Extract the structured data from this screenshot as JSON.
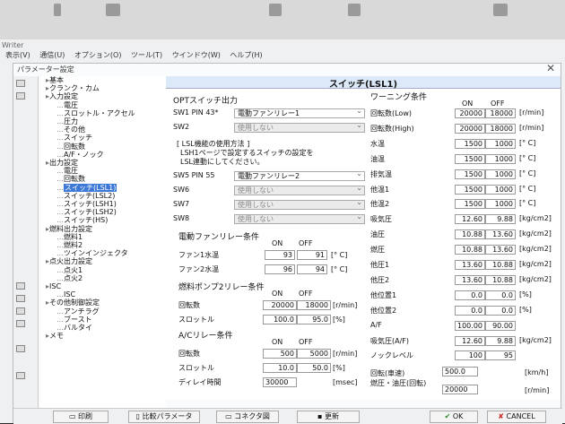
{
  "app": {
    "title": "Writer",
    "menu": [
      "表示(V)",
      "通信(U)",
      "オプション(O)",
      "ツール(T)",
      "ウインドウ(W)",
      "ヘルプ(H)"
    ],
    "dialog_title": "パラメーター設定"
  },
  "tree": [
    {
      "label": "基本",
      "indent": 0
    },
    {
      "label": "クランク・カム",
      "indent": 0
    },
    {
      "label": "入力設定",
      "indent": 0
    },
    {
      "label": "電圧",
      "indent": 1
    },
    {
      "label": "スロットル・アクセル",
      "indent": 1
    },
    {
      "label": "圧力",
      "indent": 1
    },
    {
      "label": "その他",
      "indent": 1
    },
    {
      "label": "スイッチ",
      "indent": 1
    },
    {
      "label": "回転数",
      "indent": 1
    },
    {
      "label": "A/F・ノック",
      "indent": 1
    },
    {
      "label": "出力設定",
      "indent": 0
    },
    {
      "label": "電圧",
      "indent": 1
    },
    {
      "label": "回転数",
      "indent": 1
    },
    {
      "label": "スイッチ(LSL1)",
      "indent": 1,
      "selected": true
    },
    {
      "label": "スイッチ(LSL2)",
      "indent": 1
    },
    {
      "label": "スイッチ(LSH1)",
      "indent": 1
    },
    {
      "label": "スイッチ(LSH2)",
      "indent": 1
    },
    {
      "label": "スイッチ(HS)",
      "indent": 1
    },
    {
      "label": "燃料出力設定",
      "indent": 0
    },
    {
      "label": "燃料1",
      "indent": 1
    },
    {
      "label": "燃料2",
      "indent": 1
    },
    {
      "label": "ツインインジェクタ",
      "indent": 1
    },
    {
      "label": "点火出力設定",
      "indent": 0
    },
    {
      "label": "点火1",
      "indent": 1
    },
    {
      "label": "点火2",
      "indent": 1
    },
    {
      "label": "ISC",
      "indent": 0
    },
    {
      "label": "ISC",
      "indent": 1
    },
    {
      "label": "その他制御設定",
      "indent": 0
    },
    {
      "label": "アンチラグ",
      "indent": 1
    },
    {
      "label": "ブースト",
      "indent": 1
    },
    {
      "label": "バルタイ",
      "indent": 1
    },
    {
      "label": "メモ",
      "indent": 0
    }
  ],
  "panel": {
    "title": "スイッチ(LSL1)",
    "opt_header": "OPTスイッチ出力",
    "sw1_label": "SW1 PIN 43*",
    "sw1_value": "電動ファンリレー1",
    "sw2_label": "SW2",
    "sw2_value": "使用しない",
    "note_line1": "[ LSL機能の使用方法 ]",
    "note_line2": "LSH1ページで設定するスイッチの設定を",
    "note_line3": "LSL連動にしてください。",
    "sw5_label": "SW5 PIN 55",
    "sw5_value": "電動ファンリレー2",
    "sw6_label": "SW6",
    "sw6_value": "使用しない",
    "sw7_label": "SW7",
    "sw7_value": "使用しない",
    "sw8_label": "SW8",
    "sw8_value": "使用しない",
    "fan_header": "電動ファンリレー条件",
    "on": "ON",
    "off": "OFF",
    "fan1_label": "ファン1水温",
    "fan1_on": "93",
    "fan1_off": "91",
    "fan1_unit": "[° C]",
    "fan2_label": "ファン2水温",
    "fan2_on": "96",
    "fan2_off": "94",
    "fan2_unit": "[° C]",
    "pump_header": "燃料ポンプ2リレー条件",
    "pump_rpm_label": "回転数",
    "pump_rpm_on": "20000",
    "pump_rpm_off": "18000",
    "pump_rpm_unit": "[r/min]",
    "pump_thr_label": "スロットル",
    "pump_thr_on": "100.0",
    "pump_thr_off": "95.0",
    "pump_thr_unit": "[%]",
    "ac_header": "A/Cリレー条件",
    "ac_rpm_label": "回転数",
    "ac_rpm_on": "500",
    "ac_rpm_off": "5000",
    "ac_rpm_unit": "[r/min]",
    "ac_thr_label": "スロットル",
    "ac_thr_on": "10.0",
    "ac_thr_off": "50.0",
    "ac_thr_unit": "[%]",
    "delay_label": "ディレイ時間",
    "delay_value": "30000",
    "delay_unit": "[msec]",
    "warn_header": "ワーニング条件",
    "warnings": [
      {
        "label": "回転数(Low)",
        "on": "20000",
        "off": "18000",
        "unit": "[r/min]"
      },
      {
        "label": "回転数(High)",
        "on": "20000",
        "off": "18000",
        "unit": "[r/min]"
      },
      {
        "label": "水温",
        "on": "1500",
        "off": "1000",
        "unit": "[° C]"
      },
      {
        "label": "油温",
        "on": "1500",
        "off": "1000",
        "unit": "[° C]"
      },
      {
        "label": "排気温",
        "on": "1500",
        "off": "1000",
        "unit": "[° C]"
      },
      {
        "label": "他温1",
        "on": "1500",
        "off": "1000",
        "unit": "[° C]"
      },
      {
        "label": "他温2",
        "on": "1500",
        "off": "1000",
        "unit": "[° C]"
      },
      {
        "label": "吸気圧",
        "on": "12.60",
        "off": "9.88",
        "unit": "[kg/cm2]"
      },
      {
        "label": "油圧",
        "on": "10.88",
        "off": "13.60",
        "unit": "[kg/cm2]"
      },
      {
        "label": "燃圧",
        "on": "10.88",
        "off": "13.60",
        "unit": "[kg/cm2]"
      },
      {
        "label": "他圧1",
        "on": "13.60",
        "off": "10.88",
        "unit": "[kg/cm2]"
      },
      {
        "label": "他圧2",
        "on": "13.60",
        "off": "10.88",
        "unit": "[kg/cm2]"
      },
      {
        "label": "他位置1",
        "on": "0.0",
        "off": "0.0",
        "unit": "[%]"
      },
      {
        "label": "他位置2",
        "on": "0.0",
        "off": "0.0",
        "unit": "[%]"
      },
      {
        "label": "A/F",
        "on": "100.00",
        "off": "90.00",
        "unit": ""
      },
      {
        "label": "吸気圧(A/F)",
        "on": "12.60",
        "off": "9.88",
        "unit": "[kg/cm2]"
      },
      {
        "label": "ノックレベル",
        "on": "100",
        "off": "95",
        "unit": ""
      }
    ],
    "speed_label": "回転(車速)",
    "speed_value": "500.0",
    "speed_unit": "[km/h]",
    "fuel_label": "燃圧・油圧(回転)",
    "fuel_value": "20000",
    "fuel_unit": "[r/min]"
  },
  "buttons": {
    "print": "印刷",
    "compare": "比較パラメータ",
    "connector": "コネクタ図",
    "update": "更新",
    "ok": "OK",
    "cancel": "CANCEL"
  }
}
